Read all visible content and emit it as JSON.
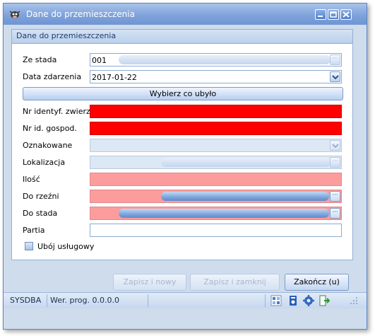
{
  "window": {
    "title": "Dane do przemieszczenia"
  },
  "panel": {
    "title": "Dane do przemieszczenia"
  },
  "fields": {
    "ze_stada": {
      "label": "Ze stada",
      "value": "001"
    },
    "data_zdarzenia": {
      "label": "Data zdarzenia",
      "value": "2017-01-22"
    },
    "nr_identyf": {
      "label": "Nr identyf. zwierz.",
      "value": ""
    },
    "nr_id_gospod": {
      "label": "Nr id. gospod.",
      "value": ""
    },
    "oznakowane": {
      "label": "Oznakowane",
      "value": ""
    },
    "lokalizacja": {
      "label": "Lokalizacja",
      "value": ""
    },
    "ilosc": {
      "label": "Ilość",
      "value": ""
    },
    "do_rzezni": {
      "label": "Do rzeźni",
      "value": ""
    },
    "do_stada": {
      "label": "Do stada",
      "value": ""
    },
    "partia": {
      "label": "Partia",
      "value": ""
    }
  },
  "ellipsis_glyph": "···",
  "wybierz_button": "Wybierz co ubyło",
  "uboj_checkbox": {
    "label": "Ubój usługowy",
    "checked": false
  },
  "buttons": {
    "zapisz_i_nowy": "Zapisz i nowy",
    "zapisz_i_zamknij": "Zapisz i zamknij",
    "zakoncz": "Zakończ (u)"
  },
  "statusbar": {
    "user": "SYSDBA",
    "version": "Wer. prog. 0.0.0.0"
  },
  "colors": {
    "required_empty": "#ff0000",
    "required_pink": "#fc9c9c",
    "title_bar": "#7fa2da"
  }
}
